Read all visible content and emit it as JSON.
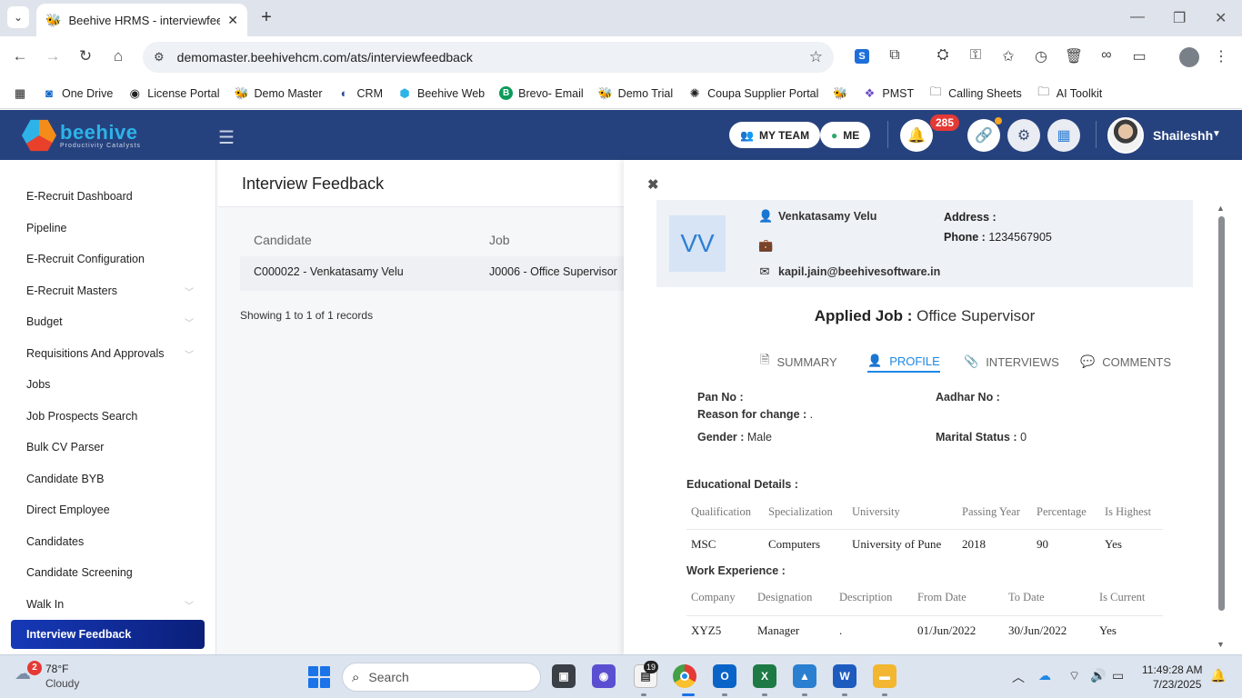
{
  "browser": {
    "tab_title": "Beehive HRMS - interviewfeedb",
    "url": "demomaster.beehivehcm.com/ats/interviewfeedback",
    "bookmarks": [
      {
        "label": "One Drive",
        "icon": "outlook-icon"
      },
      {
        "label": "License Portal",
        "icon": "globe-icon"
      },
      {
        "label": "Demo Master",
        "icon": "bee-icon"
      },
      {
        "label": "CRM",
        "icon": "crm-icon"
      },
      {
        "label": "Beehive Web",
        "icon": "beehive-icon"
      },
      {
        "label": "Brevo- Email",
        "icon": "brevo-icon"
      },
      {
        "label": "Demo Trial",
        "icon": "bee-icon"
      },
      {
        "label": "Coupa Supplier Portal",
        "icon": "coupa-icon"
      },
      {
        "label": "",
        "icon": "bee-icon"
      },
      {
        "label": "PMST",
        "icon": "pmst-icon"
      },
      {
        "label": "Calling Sheets",
        "icon": "folder-icon"
      },
      {
        "label": "AI Toolkit",
        "icon": "folder-icon"
      }
    ]
  },
  "header": {
    "logo_name": "beehive",
    "logo_tagline": "Productivity Catalysts",
    "my_team_label": "MY TEAM",
    "me_label": "ME",
    "notification_count": "285",
    "user_name": "Shaileshh",
    "colors": {
      "bar": "#26427e",
      "bell": "#e53935",
      "link": "#f6a623"
    }
  },
  "sidebar": {
    "items": [
      {
        "label": "E-Recruit Dashboard",
        "has_children": false
      },
      {
        "label": "Pipeline",
        "has_children": false
      },
      {
        "label": "E-Recruit Configuration",
        "has_children": false
      },
      {
        "label": "E-Recruit Masters",
        "has_children": true
      },
      {
        "label": "Budget",
        "has_children": true
      },
      {
        "label": "Requisitions And Approvals",
        "has_children": true
      },
      {
        "label": "Jobs",
        "has_children": false
      },
      {
        "label": "Job Prospects Search",
        "has_children": false
      },
      {
        "label": "Bulk CV Parser",
        "has_children": false
      },
      {
        "label": "Candidate BYB",
        "has_children": false
      },
      {
        "label": "Direct Employee",
        "has_children": false
      },
      {
        "label": "Candidates",
        "has_children": false
      },
      {
        "label": "Candidate Screening",
        "has_children": false
      },
      {
        "label": "Walk In",
        "has_children": true
      },
      {
        "label": "Interview Feedback",
        "has_children": false,
        "active": true
      }
    ]
  },
  "main": {
    "title": "Interview Feedback",
    "columns": [
      "Candidate",
      "Job"
    ],
    "rows": [
      [
        "C000022 - Venkatasamy Velu",
        "J0006 - Office Supervisor"
      ]
    ],
    "showing": "Showing 1 to 1 of 1 records"
  },
  "drawer": {
    "initials": "VV",
    "candidate_name": "Venkatasamy Velu",
    "email": "kapil.jain@beehivesoftware.in",
    "address_label": "Address :",
    "address_value": "",
    "phone_label": "Phone :",
    "phone_value": "1234567905",
    "applied_label": "Applied Job :",
    "applied_value": "Office Supervisor",
    "tabs": [
      {
        "label": "SUMMARY",
        "icon": "document-icon"
      },
      {
        "label": "PROFILE",
        "icon": "user-icon",
        "active": true
      },
      {
        "label": "INTERVIEWS",
        "icon": "paperclip-icon"
      },
      {
        "label": "COMMENTS",
        "icon": "comments-icon"
      }
    ],
    "profile": {
      "pan_label": "Pan No :",
      "pan_value": "",
      "aadhar_label": "Aadhar No :",
      "aadhar_value": "",
      "reason_label": "Reason for change :",
      "reason_value": ".",
      "gender_label": "Gender :",
      "gender_value": "Male",
      "marital_label": "Marital Status :",
      "marital_value": "0"
    },
    "education": {
      "title": "Educational Details :",
      "columns": [
        "Qualification",
        "Specialization",
        "University",
        "Passing Year",
        "Percentage",
        "Is Highest"
      ],
      "rows": [
        [
          "MSC",
          "Computers",
          "University of Pune",
          "2018",
          "90",
          "Yes"
        ]
      ]
    },
    "experience": {
      "title": "Work Experience :",
      "columns": [
        "Company",
        "Designation",
        "Description",
        "From Date",
        "To Date",
        "Is Current"
      ],
      "rows": [
        [
          "XYZ5",
          "Manager",
          ".",
          "01/Jun/2022",
          "30/Jun/2022",
          "Yes"
        ]
      ]
    }
  },
  "taskbar": {
    "weather_badge": "2",
    "temperature": "78°F",
    "condition": "Cloudy",
    "search_placeholder": "Search",
    "notes_badge": "19",
    "time": "11:49:28 AM",
    "date": "7/23/2025"
  }
}
